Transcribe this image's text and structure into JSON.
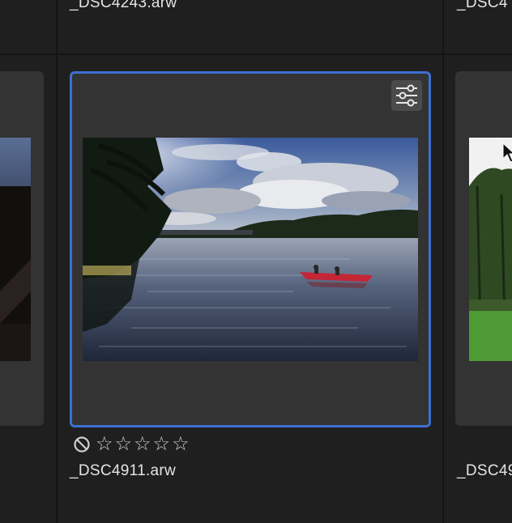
{
  "grid": {
    "top_row": {
      "center_filename": "_DSC4243.arw",
      "right_filename": "_DSC4"
    },
    "selected_item": {
      "filename": "_DSC4911.arw",
      "rating_stars": 0,
      "max_stars": 5,
      "adjust_icon": "sliders-icon",
      "reject_icon": "reject-flag-icon"
    },
    "right_item": {
      "filename": "_DSC49"
    }
  },
  "colors": {
    "background": "#1f1f1f",
    "card": "#333333",
    "selection_border": "#3d6fd2"
  }
}
